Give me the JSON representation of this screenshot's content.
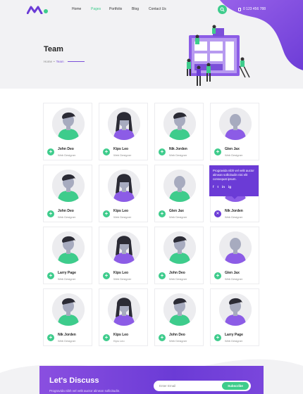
{
  "header": {
    "nav": [
      {
        "label": "Home",
        "active": false
      },
      {
        "label": "Pages",
        "active": true
      },
      {
        "label": "Portfolio",
        "active": false
      },
      {
        "label": "Blog",
        "active": false
      },
      {
        "label": "Contact Us",
        "active": false
      }
    ],
    "phone": "0 123 456 788"
  },
  "hero": {
    "title": "Team",
    "breadcrumb": [
      "Home",
      "Team"
    ]
  },
  "colors": {
    "accent_green": "#3ecc8c",
    "accent_purple": "#6b3bd6",
    "hero_bg": "#f2f2f4"
  },
  "team": [
    {
      "name": "John Deo",
      "role": "Web Designer",
      "shirt": "green",
      "hair": "short"
    },
    {
      "name": "Kips Leo",
      "role": "Web Designer",
      "shirt": "purple",
      "hair": "long"
    },
    {
      "name": "Nik Jorden",
      "role": "Web Designer",
      "shirt": "green",
      "hair": "short"
    },
    {
      "name": "Glen Jax",
      "role": "Web Designer",
      "shirt": "purple",
      "hair": "none"
    },
    {
      "name": "John Deo",
      "role": "Web Designer",
      "shirt": "green",
      "hair": "short"
    },
    {
      "name": "Kips Leo",
      "role": "Web Designer",
      "shirt": "purple",
      "hair": "long"
    },
    {
      "name": "Glen Jax",
      "role": "Web Designer",
      "shirt": "green",
      "hair": "none"
    },
    {
      "name": "Nik Jorden",
      "role": "Web Designer",
      "shirt": "purple",
      "hair": "short",
      "expanded": true
    },
    {
      "name": "Larry Page",
      "role": "Web Designer",
      "shirt": "green",
      "hair": "short"
    },
    {
      "name": "Kips Leo",
      "role": "Web Designer",
      "shirt": "purple",
      "hair": "long"
    },
    {
      "name": "John Deo",
      "role": "Web Designer",
      "shirt": "green",
      "hair": "short"
    },
    {
      "name": "Glen Jax",
      "role": "Web Designer",
      "shirt": "purple",
      "hair": "none"
    },
    {
      "name": "Nik Jorden",
      "role": "Web Designer",
      "shirt": "green",
      "hair": "short"
    },
    {
      "name": "Kips Leo",
      "role": "Kips Leo",
      "shirt": "purple",
      "hair": "long"
    },
    {
      "name": "John Deo",
      "role": "Web Designer",
      "shirt": "green",
      "hair": "short"
    },
    {
      "name": "Larry Page",
      "role": "Web Designer",
      "shirt": "purple",
      "hair": "short"
    }
  ],
  "popover": {
    "text": "Progravida nibh vel velit auctor alinean sollicitudin nisi elit consequat ipsum.",
    "socials": [
      "f",
      "t",
      "in",
      "ig"
    ]
  },
  "newsletter": {
    "title": "Let's Discuss",
    "subtitle": "Progravida nibh vel velit auctor alinean sollicitudin.",
    "placeholder": "Enter Email",
    "button": "Subscribe"
  }
}
